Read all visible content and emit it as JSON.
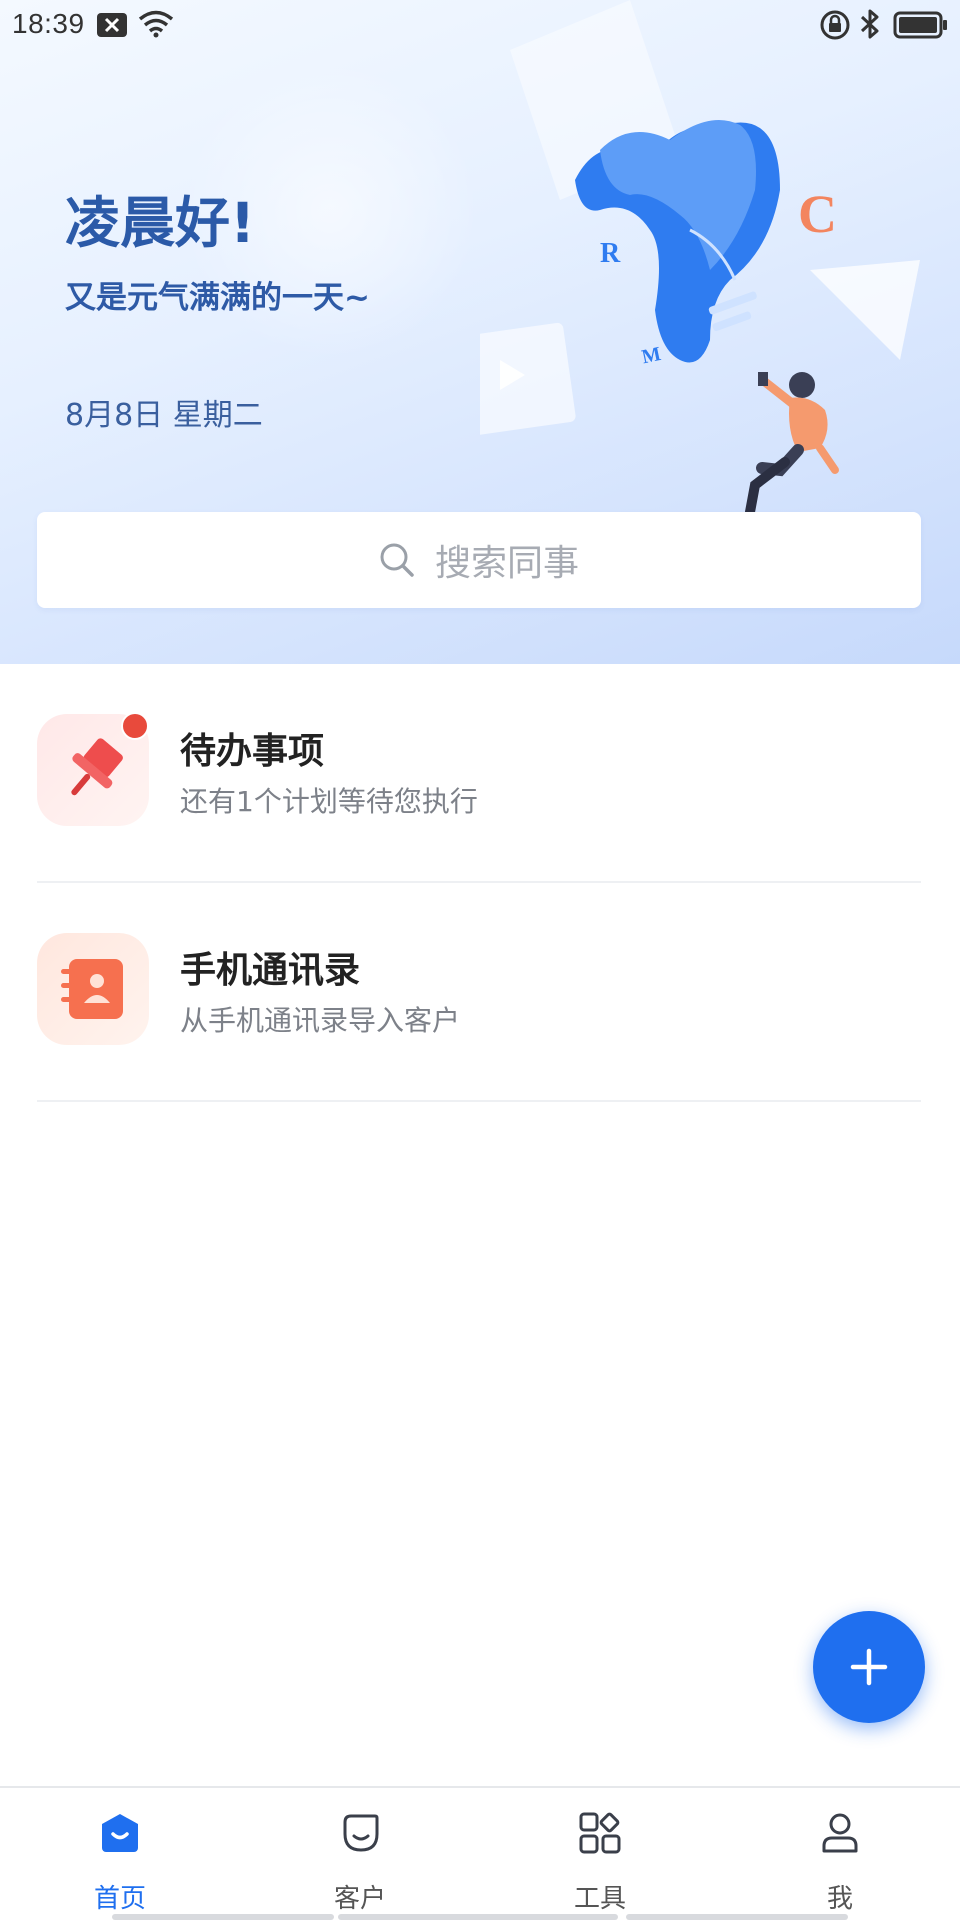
{
  "status_bar": {
    "time": "18:39"
  },
  "hero": {
    "greeting": "凌晨好!",
    "subtitle": "又是元气满满的一天~",
    "date": "8月8日 星期二",
    "illustration_letters": [
      "R",
      "C",
      "M"
    ]
  },
  "search": {
    "placeholder": "搜索同事"
  },
  "list": {
    "items": [
      {
        "title": "待办事项",
        "subtitle": "还有1个计划等待您执行",
        "icon": "pin-icon",
        "has_badge": true
      },
      {
        "title": "手机通讯录",
        "subtitle": "从手机通讯录导入客户",
        "icon": "contacts-book-icon",
        "has_badge": false
      }
    ]
  },
  "fab": {
    "icon": "plus-icon"
  },
  "bottom_nav": {
    "items": [
      {
        "label": "首页",
        "icon": "home-icon",
        "active": true
      },
      {
        "label": "客户",
        "icon": "customer-icon",
        "active": false
      },
      {
        "label": "工具",
        "icon": "tools-icon",
        "active": false
      },
      {
        "label": "我",
        "icon": "profile-icon",
        "active": false
      }
    ]
  },
  "colors": {
    "accent": "#1f6fef",
    "greeting_text": "#2b5aa8",
    "badge_red": "#e84a3c",
    "icon_red": "#ee4d4d",
    "icon_orange": "#f6704f"
  }
}
